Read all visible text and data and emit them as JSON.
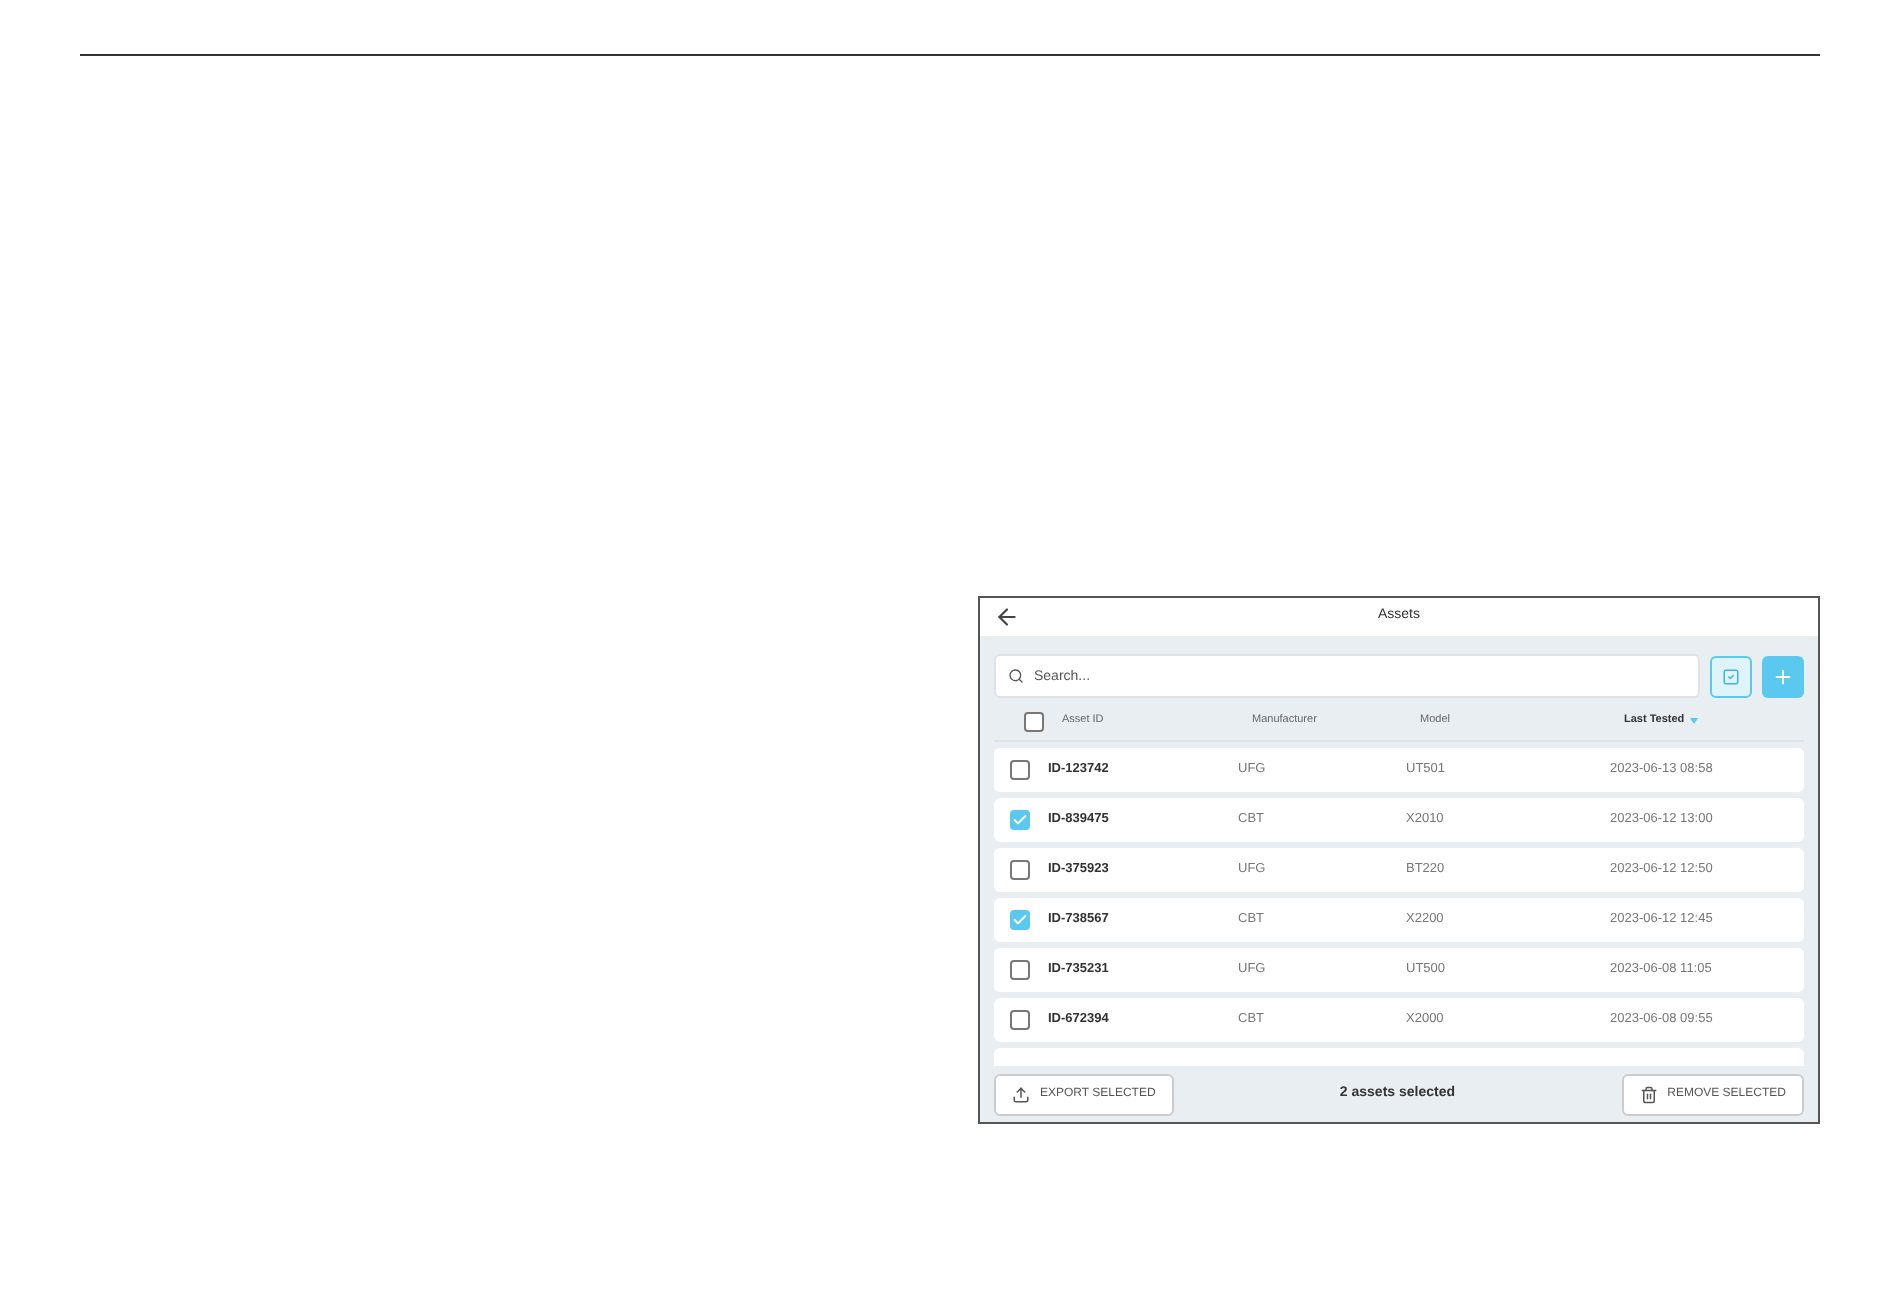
{
  "title": "Assets",
  "search": {
    "placeholder": "Search..."
  },
  "columns": [
    {
      "label": "Asset ID",
      "sorted": false
    },
    {
      "label": "Manufacturer",
      "sorted": false
    },
    {
      "label": "Model",
      "sorted": false
    },
    {
      "label": "Last Tested",
      "sorted": true
    }
  ],
  "select_all": {
    "checked": false
  },
  "rows": [
    {
      "id": "ID-123742",
      "manufacturer": "UFG",
      "model": "UT501",
      "last_tested": "2023-06-13 08:58",
      "checked": false
    },
    {
      "id": "ID-839475",
      "manufacturer": "CBT",
      "model": "X2010",
      "last_tested": "2023-06-12 13:00",
      "checked": true
    },
    {
      "id": "ID-375923",
      "manufacturer": "UFG",
      "model": "BT220",
      "last_tested": "2023-06-12 12:50",
      "checked": false
    },
    {
      "id": "ID-738567",
      "manufacturer": "CBT",
      "model": "X2200",
      "last_tested": "2023-06-12 12:45",
      "checked": true
    },
    {
      "id": "ID-735231",
      "manufacturer": "UFG",
      "model": "UT500",
      "last_tested": "2023-06-08 11:05",
      "checked": false
    },
    {
      "id": "ID-672394",
      "manufacturer": "CBT",
      "model": "X2000",
      "last_tested": "2023-06-08 09:55",
      "checked": false
    }
  ],
  "footer": {
    "export": "EXPORT SELECTED",
    "status": "2 assets selected",
    "remove": "REMOVE SELECTED"
  }
}
